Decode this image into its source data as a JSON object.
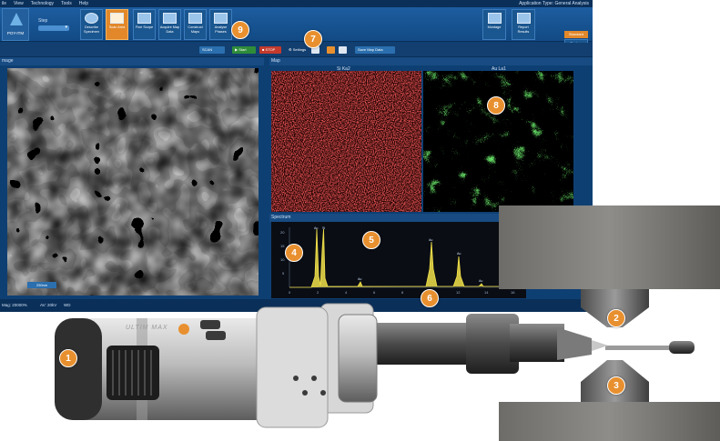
{
  "menubar": {
    "items": [
      "ile",
      "View",
      "Technology",
      "Tools",
      "Help"
    ],
    "app_type": "Application Type: General Analysis"
  },
  "ribbon": {
    "logo_label": "POY-ITM",
    "step_label": "Step",
    "steps": [
      {
        "label": "Describe Specimen",
        "active": false
      },
      {
        "label": "Scan Area",
        "active": true
      },
      {
        "label": "Fine Scope",
        "active": false
      },
      {
        "label": "Acquire Map Data",
        "active": false
      },
      {
        "label": "Construct Maps",
        "active": false
      },
      {
        "label": "Analyse Phases",
        "active": false
      }
    ],
    "montage_label": "Montage",
    "report_label": "Report Results",
    "standard_label": "Standard",
    "custom_label": "Custom"
  },
  "toolbar": {
    "scan_label": "SCAN",
    "start_label": "Start",
    "stop_label": "STOP",
    "settings_label": "Settings",
    "save_label": "Save Map Data"
  },
  "panels": {
    "image_title": "mage",
    "map_title": "Map",
    "map1_title": "Si Ka2",
    "map2_title": "Au La1",
    "spectrum_title": "Spectrum",
    "scale_label": "250nm"
  },
  "spectrum": {
    "y_ticks": [
      "20",
      "15",
      "10",
      "5"
    ],
    "x_ticks": [
      "0",
      "2",
      "4",
      "6",
      "8",
      "10",
      "12",
      "14",
      "16"
    ],
    "peak_labels": [
      "Au",
      "Si",
      "Au",
      "Au",
      "Au",
      "Au"
    ]
  },
  "status": {
    "mag": "Mag: 20000%",
    "kv": "AV: 20kV",
    "wd": "WD"
  },
  "hardware": {
    "detector_label": "ULTIM MAX"
  },
  "badges": [
    "1",
    "2",
    "3",
    "4",
    "5",
    "6",
    "7",
    "8",
    "9"
  ],
  "colors": {
    "accent": "#e8902f",
    "app_bg": "#0e3f73",
    "map_si": "#e81c1c",
    "map_au": "#22cc22",
    "spectrum_peak": "#f2e24a"
  }
}
